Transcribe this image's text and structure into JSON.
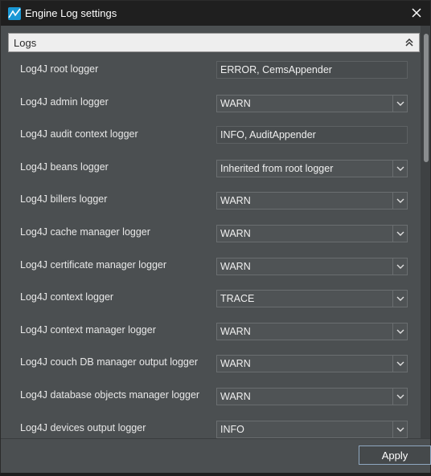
{
  "window": {
    "title": "Engine Log settings",
    "accent": "#1a98d5"
  },
  "section": {
    "title": "Logs"
  },
  "rows": [
    {
      "label": "Log4J root logger",
      "value": "ERROR, CemsAppender",
      "kind": "text"
    },
    {
      "label": "Log4J admin logger",
      "value": "WARN",
      "kind": "select"
    },
    {
      "label": "Log4J audit context logger",
      "value": "INFO, AuditAppender",
      "kind": "text"
    },
    {
      "label": "Log4J beans logger",
      "value": "Inherited from root logger",
      "kind": "select"
    },
    {
      "label": "Log4J billers logger",
      "value": "WARN",
      "kind": "select"
    },
    {
      "label": "Log4J cache manager logger",
      "value": "WARN",
      "kind": "select"
    },
    {
      "label": "Log4J certificate manager logger",
      "value": "WARN",
      "kind": "select"
    },
    {
      "label": "Log4J context logger",
      "value": "TRACE",
      "kind": "select"
    },
    {
      "label": "Log4J context manager logger",
      "value": "WARN",
      "kind": "select"
    },
    {
      "label": "Log4J couch DB manager output logger",
      "value": "WARN",
      "kind": "select"
    },
    {
      "label": "Log4J database objects manager logger",
      "value": "WARN",
      "kind": "select"
    },
    {
      "label": "Log4J devices output logger",
      "value": "INFO",
      "kind": "select"
    }
  ],
  "footer": {
    "apply_label": "Apply"
  }
}
